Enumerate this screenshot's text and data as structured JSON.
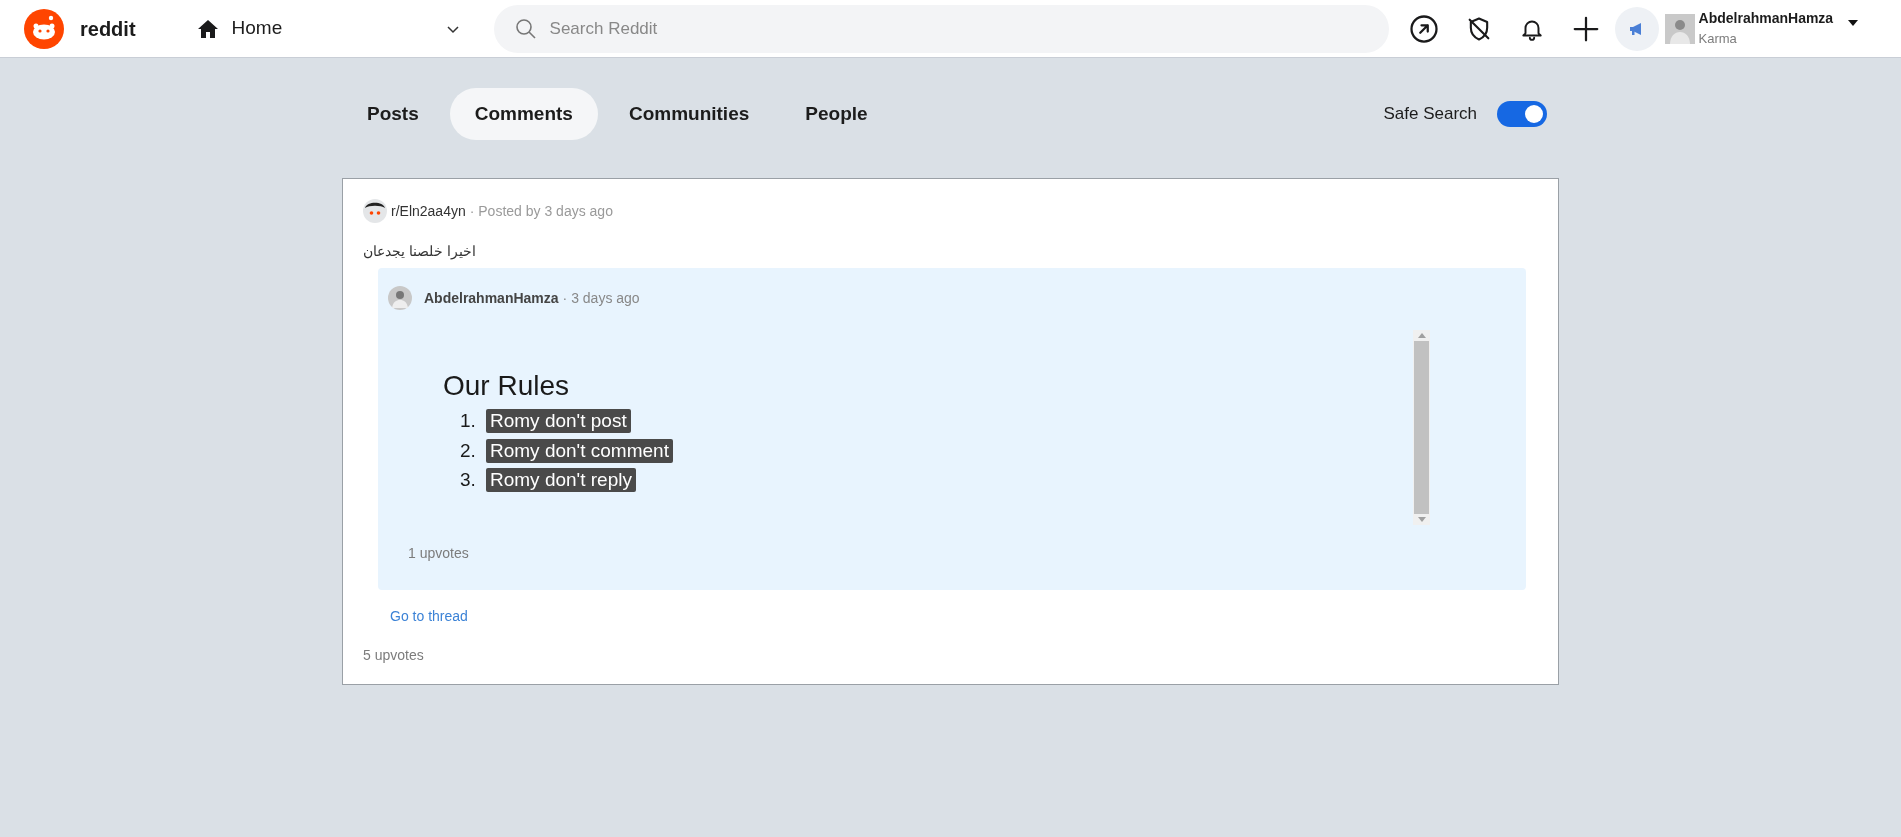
{
  "header": {
    "logo": "reddit",
    "nav": "Home",
    "search": {
      "placeholder": "Search Reddit"
    },
    "user": {
      "name": "AbdelrahmanHamza",
      "karma": "Karma"
    }
  },
  "tabs": [
    {
      "label": "Posts",
      "selected": false
    },
    {
      "label": "Comments",
      "selected": true
    },
    {
      "label": "Communities",
      "selected": false
    },
    {
      "label": "People",
      "selected": false
    }
  ],
  "safe_search": {
    "label": "Safe Search",
    "on": true
  },
  "post": {
    "community": "r/Eln2aa4yn",
    "meta": "· Posted by 3 days ago",
    "title": "اخيرا خلصنا يجدعان",
    "comment": {
      "author": "AbdelrahmanHamza",
      "time": "· 3 days ago",
      "heading": "Our Rules",
      "rules": [
        {
          "number": "1.",
          "text": "Romy don't post"
        },
        {
          "number": "2.",
          "text": "Romy don't comment"
        },
        {
          "number": "3.",
          "text": "Romy don't reply"
        }
      ],
      "upvotes": "1 upvotes"
    },
    "link": "Go to thread",
    "upvotes": "5 upvotes"
  }
}
